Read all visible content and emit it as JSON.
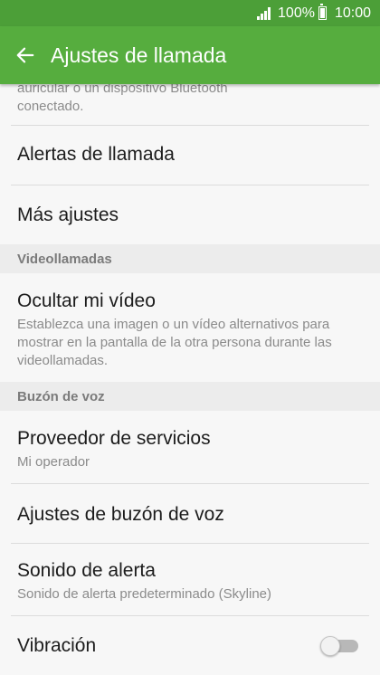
{
  "status_bar": {
    "battery_percent": "100%",
    "time": "10:00"
  },
  "app_bar": {
    "title": "Ajustes de llamada"
  },
  "partial_item": {
    "description_line1": "auricular o un dispositivo Bluetooth",
    "description_line2": "conectado."
  },
  "items": {
    "call_alerts": {
      "title": "Alertas de llamada"
    },
    "more_settings": {
      "title": "Más ajustes"
    },
    "hide_video": {
      "title": "Ocultar mi vídeo",
      "description_line1": "Establezca una imagen o un vídeo alternativos para",
      "description_line2": "mostrar en la pantalla de la otra persona durante las",
      "description_line3": "videollamadas."
    },
    "service_provider": {
      "title": "Proveedor de servicios",
      "value": "Mi operador"
    },
    "voicemail_settings": {
      "title": "Ajustes de buzón de voz"
    },
    "alert_sound": {
      "title": "Sonido de alerta",
      "value": "Sonido de alerta predeterminado (Skyline)"
    },
    "vibration": {
      "title": "Vibración",
      "enabled": false
    }
  },
  "sections": {
    "video_calls": "Videollamadas",
    "voicemail": "Buzón de voz"
  },
  "colors": {
    "status_bar": "#4c9f38",
    "app_bar": "#56ad3e",
    "background": "#f7f7f7",
    "section_header_bg": "#ececec"
  }
}
